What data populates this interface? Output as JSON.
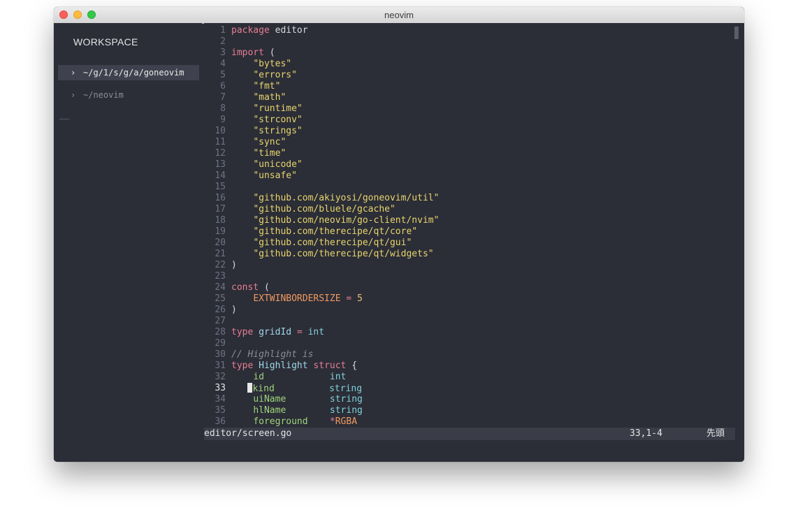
{
  "window": {
    "title": "neovim"
  },
  "workspace": {
    "title": "WORKSPACE",
    "items": [
      {
        "chevron": "›",
        "label": "~/g/1/s/g/a/goneovim",
        "active": true
      },
      {
        "chevron": "›",
        "label": "~/neovim",
        "active": false
      }
    ]
  },
  "editor": {
    "lines": [
      {
        "n": "1",
        "tokens": [
          [
            "kw-plain",
            "package "
          ],
          [
            "txt",
            "editor"
          ]
        ]
      },
      {
        "n": "2",
        "tokens": []
      },
      {
        "n": "3",
        "tokens": [
          [
            "kwb",
            "import"
          ],
          [
            "txt",
            " ("
          ]
        ]
      },
      {
        "n": "4",
        "tokens": [
          [
            "txt",
            "    "
          ],
          [
            "str",
            "\"bytes\""
          ]
        ]
      },
      {
        "n": "5",
        "tokens": [
          [
            "txt",
            "    "
          ],
          [
            "str",
            "\"errors\""
          ]
        ]
      },
      {
        "n": "6",
        "tokens": [
          [
            "txt",
            "    "
          ],
          [
            "str",
            "\"fmt\""
          ]
        ]
      },
      {
        "n": "7",
        "tokens": [
          [
            "txt",
            "    "
          ],
          [
            "str",
            "\"math\""
          ]
        ]
      },
      {
        "n": "8",
        "tokens": [
          [
            "txt",
            "    "
          ],
          [
            "str",
            "\"runtime\""
          ]
        ]
      },
      {
        "n": "9",
        "tokens": [
          [
            "txt",
            "    "
          ],
          [
            "str",
            "\"strconv\""
          ]
        ]
      },
      {
        "n": "10",
        "tokens": [
          [
            "txt",
            "    "
          ],
          [
            "str",
            "\"strings\""
          ]
        ]
      },
      {
        "n": "11",
        "tokens": [
          [
            "txt",
            "    "
          ],
          [
            "str",
            "\"sync\""
          ]
        ]
      },
      {
        "n": "12",
        "tokens": [
          [
            "txt",
            "    "
          ],
          [
            "str",
            "\"time\""
          ]
        ]
      },
      {
        "n": "13",
        "tokens": [
          [
            "txt",
            "    "
          ],
          [
            "str",
            "\"unicode\""
          ]
        ]
      },
      {
        "n": "14",
        "tokens": [
          [
            "txt",
            "    "
          ],
          [
            "str",
            "\"unsafe\""
          ]
        ]
      },
      {
        "n": "15",
        "tokens": []
      },
      {
        "n": "16",
        "tokens": [
          [
            "txt",
            "    "
          ],
          [
            "str",
            "\"github.com/akiyosi/goneovim/util\""
          ]
        ]
      },
      {
        "n": "17",
        "tokens": [
          [
            "txt",
            "    "
          ],
          [
            "str",
            "\"github.com/bluele/gcache\""
          ]
        ]
      },
      {
        "n": "18",
        "tokens": [
          [
            "txt",
            "    "
          ],
          [
            "str",
            "\"github.com/neovim/go-client/nvim\""
          ]
        ]
      },
      {
        "n": "19",
        "tokens": [
          [
            "txt",
            "    "
          ],
          [
            "str",
            "\"github.com/therecipe/qt/core\""
          ]
        ]
      },
      {
        "n": "20",
        "tokens": [
          [
            "txt",
            "    "
          ],
          [
            "str",
            "\"github.com/therecipe/qt/gui\""
          ]
        ]
      },
      {
        "n": "21",
        "tokens": [
          [
            "txt",
            "    "
          ],
          [
            "str",
            "\"github.com/therecipe/qt/widgets\""
          ]
        ]
      },
      {
        "n": "22",
        "tokens": [
          [
            "txt",
            ")"
          ]
        ]
      },
      {
        "n": "23",
        "tokens": []
      },
      {
        "n": "24",
        "tokens": [
          [
            "kw",
            "const"
          ],
          [
            "txt",
            " ("
          ]
        ]
      },
      {
        "n": "25",
        "tokens": [
          [
            "txt",
            "    "
          ],
          [
            "const",
            "EXTWINBORDERSIZE"
          ],
          [
            "txt",
            " "
          ],
          [
            "kw",
            "="
          ],
          [
            "txt",
            " "
          ],
          [
            "num",
            "5"
          ]
        ]
      },
      {
        "n": "26",
        "tokens": [
          [
            "txt",
            ")"
          ]
        ]
      },
      {
        "n": "27",
        "tokens": []
      },
      {
        "n": "28",
        "tokens": [
          [
            "kw",
            "type"
          ],
          [
            "txt",
            " "
          ],
          [
            "id",
            "gridId"
          ],
          [
            "txt",
            " "
          ],
          [
            "kw",
            "="
          ],
          [
            "txt",
            " "
          ],
          [
            "typ",
            "int"
          ]
        ]
      },
      {
        "n": "29",
        "tokens": []
      },
      {
        "n": "30",
        "tokens": [
          [
            "cmt",
            "// Highlight is"
          ]
        ]
      },
      {
        "n": "31",
        "tokens": [
          [
            "kw",
            "type"
          ],
          [
            "txt",
            " "
          ],
          [
            "id",
            "Highlight"
          ],
          [
            "txt",
            " "
          ],
          [
            "kw",
            "struct"
          ],
          [
            "txt",
            " {"
          ]
        ]
      },
      {
        "n": "32",
        "tokens": [
          [
            "txt",
            "    "
          ],
          [
            "fld",
            "id"
          ],
          [
            "txt",
            "            "
          ],
          [
            "typ",
            "int"
          ]
        ]
      },
      {
        "n": "33",
        "current": true,
        "tokens": [
          [
            "txt",
            "   "
          ],
          [
            "cursor",
            ""
          ],
          [
            "fld",
            "kind"
          ],
          [
            "txt",
            "          "
          ],
          [
            "typ",
            "string"
          ]
        ]
      },
      {
        "n": "34",
        "tokens": [
          [
            "txt",
            "    "
          ],
          [
            "fld",
            "uiName"
          ],
          [
            "txt",
            "        "
          ],
          [
            "typ",
            "string"
          ]
        ]
      },
      {
        "n": "35",
        "tokens": [
          [
            "txt",
            "    "
          ],
          [
            "fld",
            "hlName"
          ],
          [
            "txt",
            "        "
          ],
          [
            "typ",
            "string"
          ]
        ]
      },
      {
        "n": "36",
        "tokens": [
          [
            "txt",
            "    "
          ],
          [
            "fld",
            "foreground"
          ],
          [
            "txt",
            "    "
          ],
          [
            "kw",
            "*"
          ],
          [
            "const",
            "RGBA"
          ]
        ]
      }
    ]
  },
  "statusline": {
    "file": "editor/screen.go",
    "position": "33,1-4",
    "scroll": "先頭"
  },
  "colors": {
    "background": "#2b2d37",
    "keyword": "#e67e93",
    "string": "#e8d56c",
    "identifier": "#9fd7e8",
    "field": "#9fd47b",
    "constant": "#ef9a61"
  }
}
